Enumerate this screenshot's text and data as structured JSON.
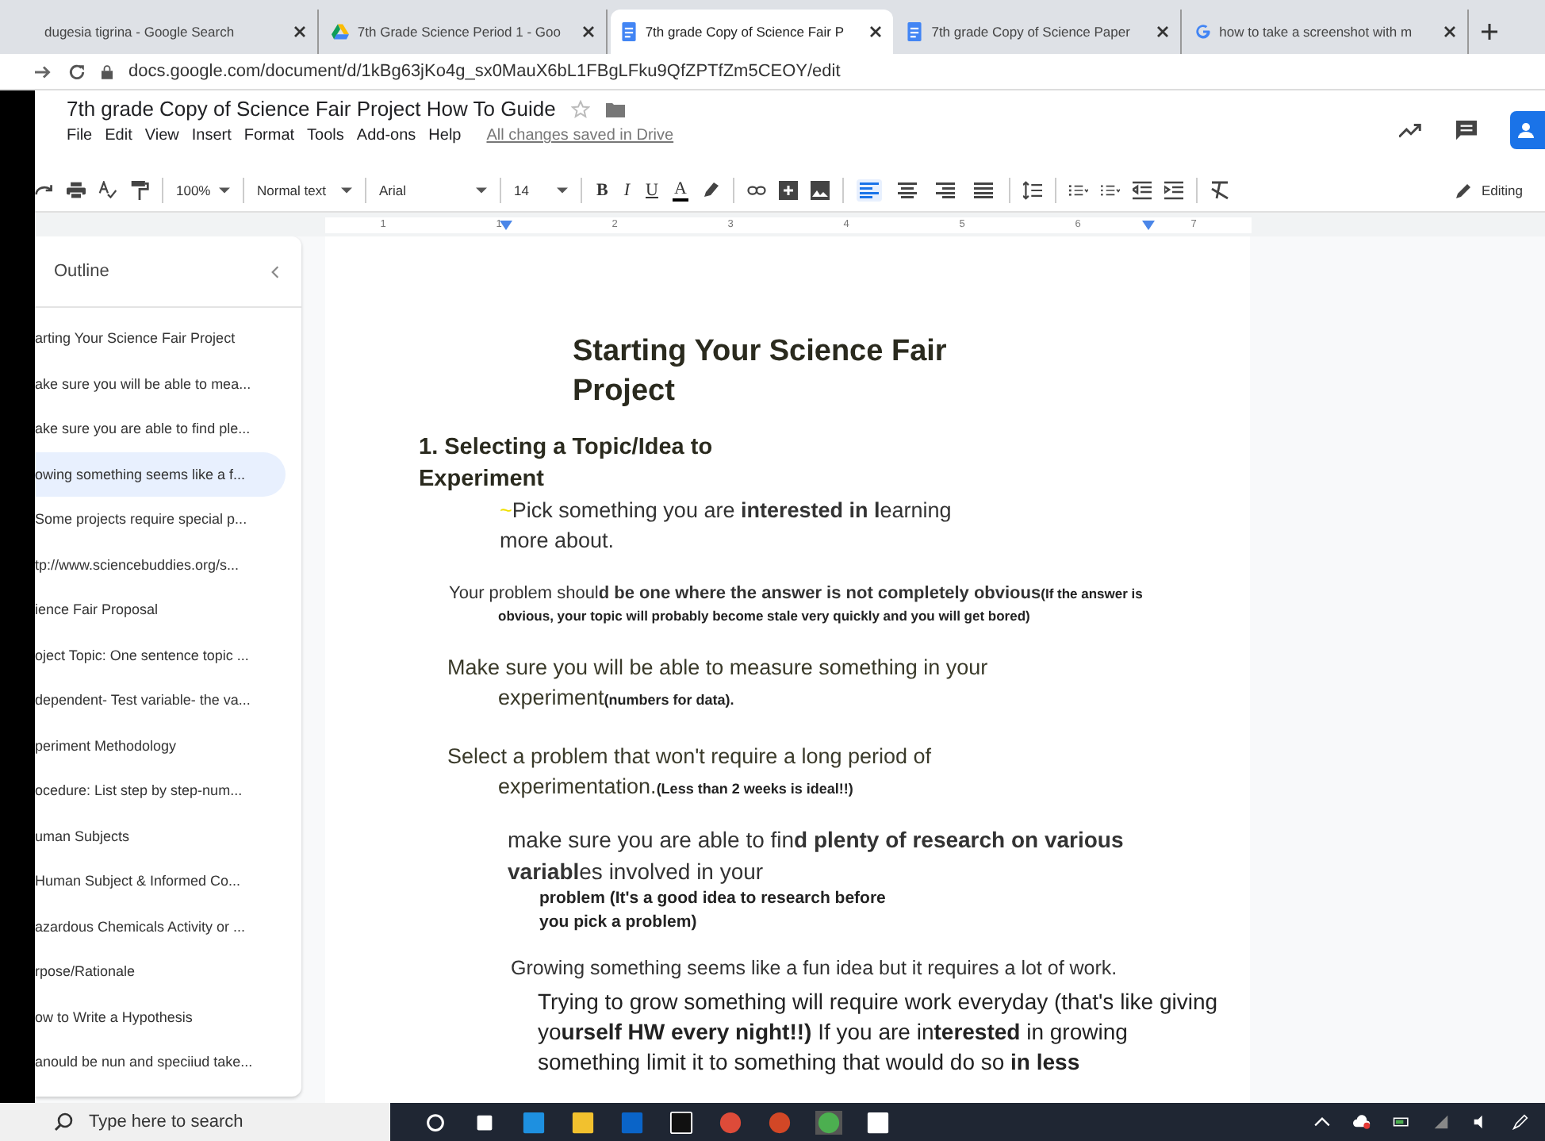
{
  "browser_tabs": [
    {
      "title": "dugesia tigrina - Google Search",
      "selected": false
    },
    {
      "title": "7th Grade Science Period 1 - Goo",
      "selected": false
    },
    {
      "title": "7th grade Copy of Science Fair P",
      "selected": true
    },
    {
      "title": "7th grade Copy of Science Paper",
      "selected": false
    },
    {
      "title": "how to take a screenshot with m",
      "selected": false
    }
  ],
  "address": "docs.google.com/document/d/1kBg63jKo4g_sx0MauX6bL1FBgLFku9QfZPTfZm5CEOY/edit",
  "doc_title": "7th grade Copy of Science Fair Project How To Guide",
  "menu": [
    "File",
    "Edit",
    "View",
    "Insert",
    "Format",
    "Tools",
    "Add-ons",
    "Help"
  ],
  "save_status": "All changes saved in Drive",
  "toolbar": {
    "zoom": "100%",
    "style": "Normal text",
    "font": "Arial",
    "size": "14",
    "format_buttons": [
      "B",
      "I",
      "U",
      "A"
    ],
    "align_buttons": [
      {
        "selected": true
      },
      {
        "selected": false
      },
      {
        "selected": false
      },
      {
        "selected": false
      }
    ],
    "mode": "Editing"
  },
  "ruler": [
    "1",
    "1",
    "2",
    "3",
    "4",
    "5",
    "6",
    "7"
  ],
  "outline": {
    "title": "Outline",
    "items": [
      {
        "label": "arting Your Science Fair Project",
        "selected": false
      },
      {
        "label": "ake sure you will be able to mea...",
        "selected": false
      },
      {
        "label": "ake sure you are able to find ple...",
        "selected": false
      },
      {
        "label": "owing something seems like a f...",
        "selected": true
      },
      {
        "label": "Some projects require special p...",
        "selected": false
      },
      {
        "label": "tp://www.sciencebuddies.org/s...",
        "selected": false
      },
      {
        "label": "ience Fair Proposal",
        "selected": false
      },
      {
        "label": "oject Topic: One sentence topic ...",
        "selected": false
      },
      {
        "label": "dependent- Test variable- the va...",
        "selected": false
      },
      {
        "label": "periment Methodology",
        "selected": false
      },
      {
        "label": "ocedure: List step by step-num...",
        "selected": false
      },
      {
        "label": "uman Subjects",
        "selected": false
      },
      {
        "label": "Human Subject & Informed Co...",
        "selected": false
      },
      {
        "label": "azardous Chemicals Activity or ...",
        "selected": false
      },
      {
        "label": "rpose/Rationale",
        "selected": false
      },
      {
        "label": "ow to Write a Hypothesis",
        "selected": false
      },
      {
        "label": "anould be nun and speciiud take...",
        "selected": false
      }
    ]
  },
  "document": [
    {
      "kind": "title",
      "text": "Starting Your Science Fair Project"
    },
    {
      "kind": "heading",
      "text": "1. Selecting a Topic/Idea to Experiment"
    },
    {
      "kind": "lead",
      "mark": "~",
      "text": "Pick something you are **interested in l**earning more about."
    },
    {
      "kind": "hanging-small",
      "text": "Your problem shoul**d be one where the answer is not completely obvious**",
      "note": "(If the answer is obvious, your topic will probably become stale very quickly and you will get bored)"
    },
    {
      "kind": "hanging",
      "text": "Make sure you will be able to measure something in your experiment",
      "note": "(numbers for data)."
    },
    {
      "kind": "hanging",
      "text": "Select a problem that won't require a long period of experimentation.",
      "note": "(Less than 2 weeks is ideal!!)"
    },
    {
      "kind": "body",
      "text": "make sure you are able to fin**d plenty of research on various variabl**es involved in your"
    },
    {
      "kind": "sub-note",
      "text": "problem (It's a good idea to research before you pick a problem)"
    },
    {
      "kind": "body-small",
      "text": "Growing something seems like a fun idea but it requires a lot of work."
    },
    {
      "kind": "body-indent",
      "text": "Trying to grow something will require work everyday (that's like giving yo**urself HW every night!!)** If you are in**terested** in growing something limit it to something that would do so **in less**"
    }
  ],
  "taskbar": {
    "search_placeholder": "Type here to search"
  }
}
